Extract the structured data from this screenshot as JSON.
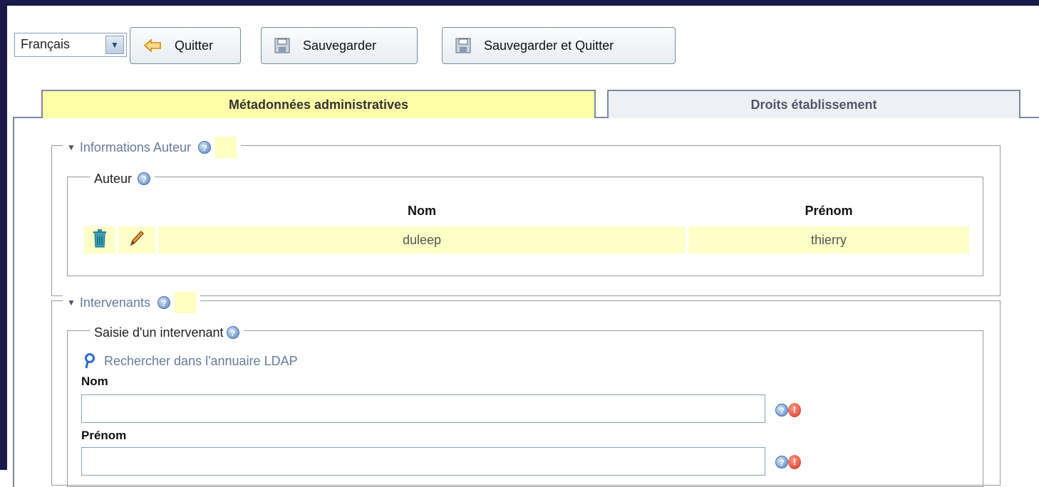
{
  "toolbar": {
    "language": "Français",
    "quit_label": "Quitter",
    "save_label": "Sauvegarder",
    "save_quit_label": "Sauvegarder et Quitter"
  },
  "tabs": [
    {
      "label": "Métadonnées administratives",
      "active": true
    },
    {
      "label": "Droits établissement",
      "active": false
    }
  ],
  "sections": {
    "author_info": {
      "legend": "Informations Auteur",
      "author": {
        "legend": "Auteur",
        "columns": [
          "Nom",
          "Prénom"
        ],
        "rows": [
          {
            "nom": "duleep",
            "prenom": "thierry"
          }
        ]
      }
    },
    "intervenants": {
      "legend": "Intervenants",
      "entry": {
        "legend": "Saisie d'un intervenant",
        "ldap_link": "Rechercher dans l'annuaire LDAP",
        "nom_label": "Nom",
        "nom_value": "",
        "prenom_label": "Prénom",
        "prenom_value": ""
      }
    }
  },
  "colors": {
    "active_tab": "#ffffa8",
    "row_highlight": "#ffffc8",
    "frame": "#1a1a4a"
  }
}
